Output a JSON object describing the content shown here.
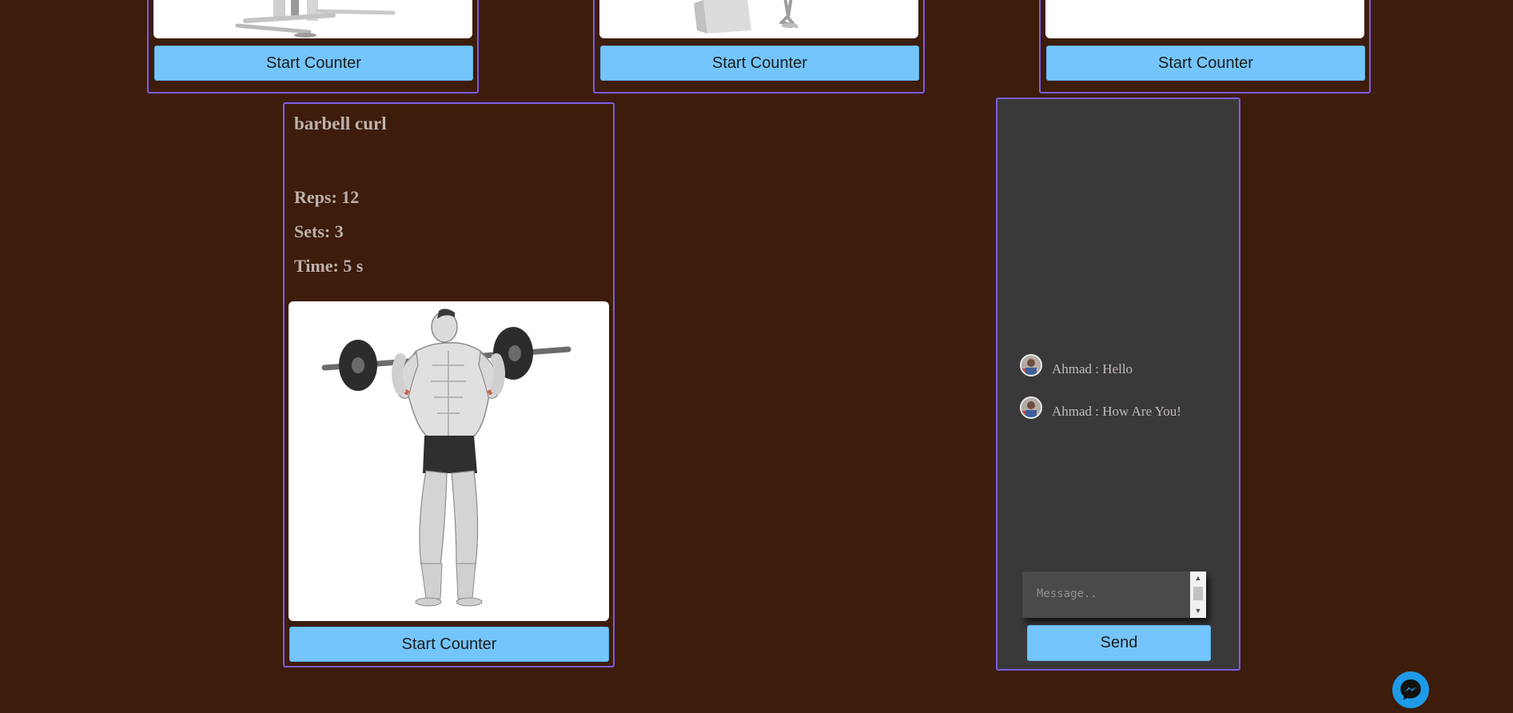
{
  "top_cards": [
    {
      "button_label": "Start Counter"
    },
    {
      "button_label": "Start Counter"
    },
    {
      "button_label": "Start Counter"
    }
  ],
  "exercise": {
    "title": "barbell curl",
    "reps": "Reps: 12",
    "sets": "Sets: 3",
    "time": "Time: 5 s",
    "button_label": "Start Counter"
  },
  "chat": {
    "messages": [
      {
        "text": "Ahmad : Hello"
      },
      {
        "text": "Ahmad : How Are You!"
      }
    ],
    "input_placeholder": "Message..",
    "send_label": "Send"
  },
  "colors": {
    "background": "#3d1c0b",
    "card_border": "#7b5ce6",
    "button": "#74c5fc",
    "chat_panel": "#393939",
    "messenger": "#1e9ae8"
  },
  "icons": {
    "messenger": "messenger-icon"
  }
}
